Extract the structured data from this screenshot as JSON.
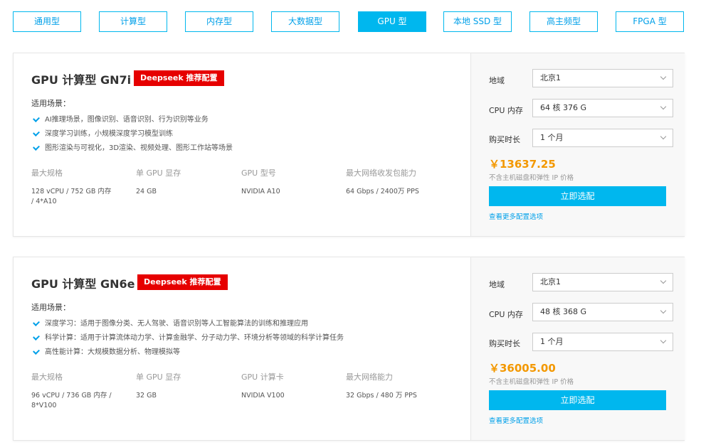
{
  "tabs": [
    {
      "label": "通用型",
      "active": false
    },
    {
      "label": "计算型",
      "active": false
    },
    {
      "label": "内存型",
      "active": false
    },
    {
      "label": "大数据型",
      "active": false
    },
    {
      "label": "GPU 型",
      "active": true
    },
    {
      "label": "本地 SSD 型",
      "active": false
    },
    {
      "label": "高主频型",
      "active": false
    },
    {
      "label": "FPGA 型",
      "active": false
    }
  ],
  "cards": [
    {
      "title": "GPU 计算型 GN7i",
      "badge": "Deepseek 推荐配置",
      "scene_label": "适用场景：",
      "scenes": [
        "AI推理场景，图像识别、语音识别、行为识别等业务",
        "深度学习训练，小规模深度学习模型训练",
        "图形渲染与可视化，3D渲染、视频处理、图形工作站等场景"
      ],
      "specs": [
        {
          "label": "最大规格",
          "value": "128 vCPU / 752 GB 内存 / 4*A10"
        },
        {
          "label": "单 GPU 显存",
          "value": "24 GB"
        },
        {
          "label": "GPU 型号",
          "value": "NVIDIA A10"
        },
        {
          "label": "最大网络收发包能力",
          "value": "64 Gbps / 2400万 PPS"
        }
      ],
      "region_label": "地域",
      "region_value": "北京1",
      "cpu_label": "CPU 内存",
      "cpu_value": "64 核 376 G",
      "duration_label": "购买时长",
      "duration_value": "1 个月",
      "price": "￥13637.25",
      "price_note": "不含主机磁盘和弹性 IP 价格",
      "buy_label": "立即选配",
      "more_label": "查看更多配置选项"
    },
    {
      "title": "GPU 计算型 GN6e",
      "badge": "Deepseek 推荐配置",
      "scene_label": "适用场景：",
      "scenes": [
        "深度学习：适用于图像分类、无人驾驶、语音识别等人工智能算法的训练和推理应用",
        "科学计算：适用于计算流体动力学、计算金融学、分子动力学、环境分析等领域的科学计算任务",
        "高性能计算：大规模数据分析、物理模拟等"
      ],
      "specs": [
        {
          "label": "最大规格",
          "value": "96 vCPU / 736 GB 内存 / 8*V100"
        },
        {
          "label": "单 GPU 显存",
          "value": "32 GB"
        },
        {
          "label": "GPU 计算卡",
          "value": "NVIDIA V100"
        },
        {
          "label": "最大网络能力",
          "value": "32 Gbps / 480 万 PPS"
        }
      ],
      "region_label": "地域",
      "region_value": "北京1",
      "cpu_label": "CPU 内存",
      "cpu_value": "48 核 368 G",
      "duration_label": "购买时长",
      "duration_value": "1 个月",
      "price": "￥36005.00",
      "price_note": "不含主机磁盘和弹性 IP 价格",
      "buy_label": "立即选配",
      "more_label": "查看更多配置选项"
    }
  ]
}
